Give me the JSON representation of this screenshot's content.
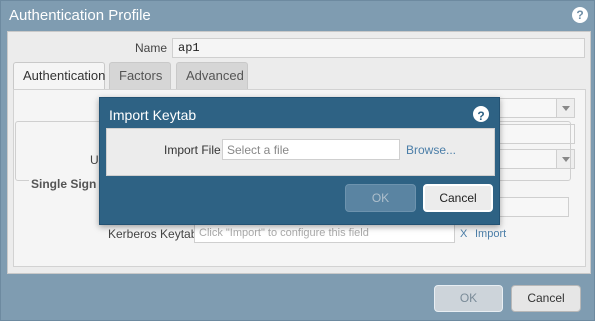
{
  "window": {
    "title": "Authentication Profile",
    "help_icon": "?"
  },
  "form": {
    "name_label": "Name",
    "name_value": "ap1"
  },
  "tabs": [
    {
      "label": "Authentication",
      "active": true
    },
    {
      "label": "Factors",
      "active": false
    },
    {
      "label": "Advanced",
      "active": false
    }
  ],
  "background": {
    "partial_label_us": "Us",
    "sso_title": "Single Sign O",
    "kerberos_label": "Kerberos Keytab",
    "kerberos_placeholder": "Click \"Import\" to configure this field",
    "kerberos_clear": "X",
    "kerberos_import": "Import"
  },
  "footer": {
    "ok_label": "OK",
    "cancel_label": "Cancel"
  },
  "modal": {
    "title": "Import Keytab",
    "help_icon": "?",
    "import_file_label": "Import File",
    "import_file_placeholder": "Select a file",
    "browse_label": "Browse...",
    "ok_label": "OK",
    "cancel_label": "Cancel"
  },
  "colors": {
    "outer_frame": "#7f9cb1",
    "modal_header": "#2e6284",
    "link": "#4b7ea8"
  }
}
